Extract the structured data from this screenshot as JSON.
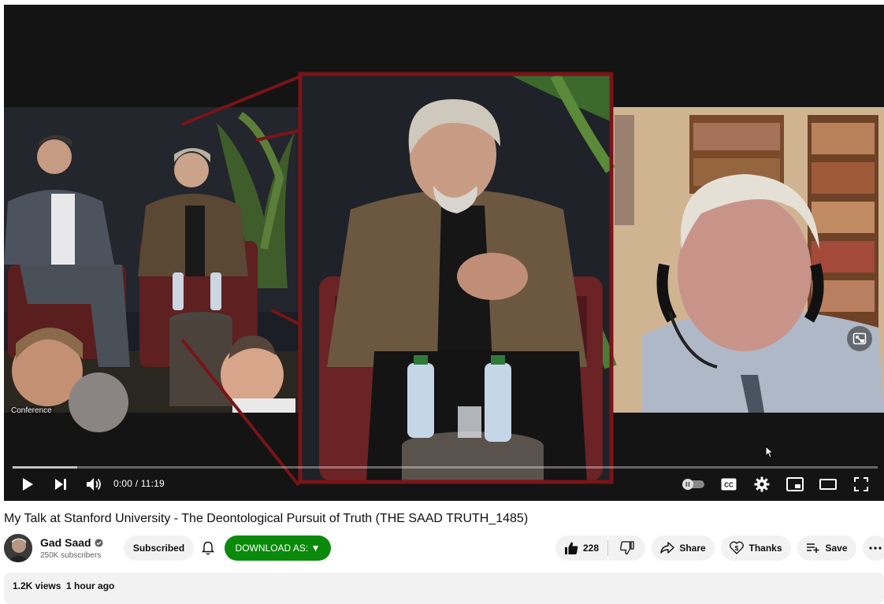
{
  "player": {
    "overlay_label": "Conference",
    "time_display": "0:00 / 11:19",
    "progress_fraction": 0.0,
    "buffer_fraction": 0.075,
    "icons": {
      "play": "play-icon",
      "next": "next-icon",
      "volume": "volume-icon",
      "autoplay": "autoplay-toggle-icon",
      "captions": "cc-icon",
      "settings": "gear-icon",
      "miniplayer": "miniplayer-icon",
      "theater": "theater-icon",
      "fullscreen": "fullscreen-icon",
      "pip": "pip-icon"
    }
  },
  "video": {
    "title": "My Talk at Stanford University - The Deontological Pursuit of Truth (THE SAAD TRUTH_1485)"
  },
  "channel": {
    "name": "Gad Saad",
    "subscribers": "250K subscribers",
    "subscribed_label": "Subscribed",
    "download_label": "DOWNLOAD AS: ▼"
  },
  "actions": {
    "like_count": "228",
    "share_label": "Share",
    "thanks_label": "Thanks",
    "save_label": "Save"
  },
  "description": {
    "meta": "1.2K views  1 hour ago"
  },
  "colors": {
    "download_green": "#0a8a0a",
    "highlight_border": "#7a1418"
  }
}
